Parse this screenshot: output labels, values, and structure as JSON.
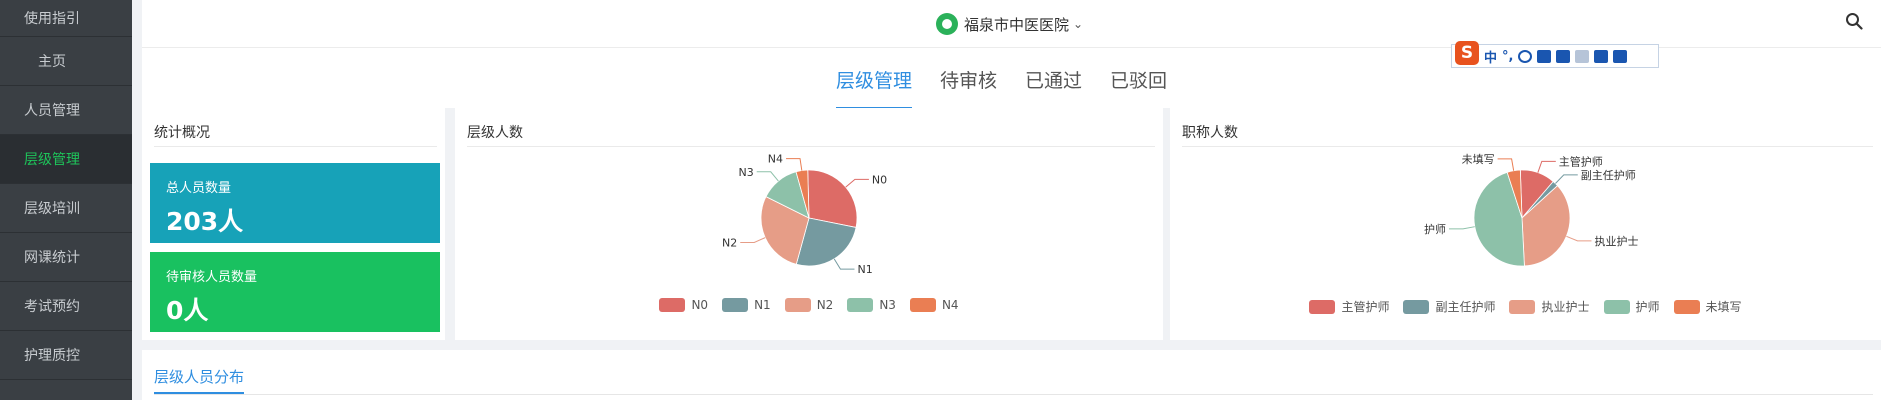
{
  "sidebar": {
    "items": [
      {
        "label": "使用指引",
        "indent": false,
        "active": false
      },
      {
        "label": "主页",
        "indent": true,
        "active": false
      },
      {
        "label": "人员管理",
        "indent": false,
        "active": false
      },
      {
        "label": "层级管理",
        "indent": false,
        "active": true
      },
      {
        "label": "层级培训",
        "indent": false,
        "active": false
      },
      {
        "label": "网课统计",
        "indent": false,
        "active": false
      },
      {
        "label": "考试预约",
        "indent": false,
        "active": false
      },
      {
        "label": "护理质控",
        "indent": false,
        "active": false
      }
    ]
  },
  "header": {
    "hospital_name": "福泉市中医医院",
    "search_icon": "search-icon"
  },
  "tabs": [
    {
      "label": "层级管理",
      "active": true
    },
    {
      "label": "待审核",
      "active": false
    },
    {
      "label": "已通过",
      "active": false
    },
    {
      "label": "已驳回",
      "active": false
    }
  ],
  "ime": {
    "logo": "S",
    "mode": "中",
    "punct": "°,"
  },
  "stats": {
    "title": "统计概况",
    "total_label": "总人员数量",
    "total_value": "203人",
    "pending_label": "待审核人员数量",
    "pending_value": "0人"
  },
  "chart_data": [
    {
      "type": "pie",
      "title": "层级人数",
      "labels": [
        "N0",
        "N1",
        "N2",
        "N3",
        "N4"
      ],
      "values": [
        58,
        53,
        57,
        27,
        8
      ],
      "colors": [
        "#dd6b66",
        "#759aa0",
        "#e69d87",
        "#8dc1a9",
        "#ea7e53"
      ],
      "legend": "bottom-center"
    },
    {
      "type": "pie",
      "title": "职称人数",
      "labels": [
        "主管护师",
        "副主任护师",
        "执业护士",
        "护师",
        "未填写"
      ],
      "values": [
        24,
        4,
        73,
        93,
        9
      ],
      "colors": [
        "#dd6b66",
        "#759aa0",
        "#e69d87",
        "#8dc1a9",
        "#ea7e53"
      ],
      "legend": "bottom-center"
    }
  ],
  "bottom": {
    "title": "层级人员分布"
  }
}
